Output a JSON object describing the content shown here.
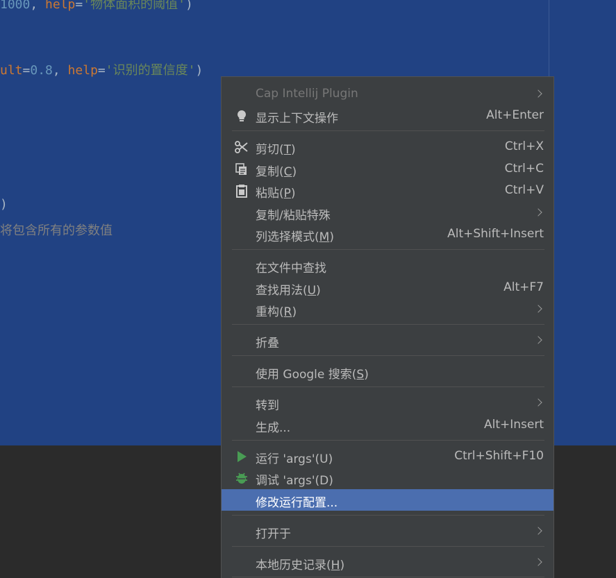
{
  "editor": {
    "line1": {
      "num": "1000",
      "sep": ", ",
      "kw": "help",
      "eq": "=",
      "str": "'物体面积的阈值'",
      "close": ")"
    },
    "line2": {
      "kw_tail": "ult",
      "eq1": "=",
      "num": "0.8",
      "sep": ", ",
      "kw": "help",
      "eq2": "=",
      "str": "'识别的置信度'",
      "close": ")"
    },
    "line3": ")",
    "comment": "将包含所有的参数值"
  },
  "context_menu": {
    "items": [
      {
        "label": "Cap Intellij Plugin",
        "shortcut": "",
        "submenu": true,
        "disabled": true,
        "icon": ""
      },
      {
        "label": "显示上下文操作",
        "shortcut": "Alt+Enter",
        "icon": "lightbulb-icon"
      },
      {
        "label_main": "剪切(",
        "mnemonic": "T",
        "label_end": ")",
        "shortcut": "Ctrl+X",
        "icon": "scissors-icon"
      },
      {
        "label_main": "复制(",
        "mnemonic": "C",
        "label_end": ")",
        "shortcut": "Ctrl+C",
        "icon": "copy-icon"
      },
      {
        "label_main": "粘贴(",
        "mnemonic": "P",
        "label_end": ")",
        "shortcut": "Ctrl+V",
        "icon": "clipboard-icon"
      },
      {
        "label": "复制/粘贴特殊",
        "submenu": true
      },
      {
        "label_main": "列选择模式(",
        "mnemonic": "M",
        "label_end": ")",
        "shortcut": "Alt+Shift+Insert"
      },
      {
        "label": "在文件中查找"
      },
      {
        "label_main": "查找用法(",
        "mnemonic": "U",
        "label_end": ")",
        "shortcut": "Alt+F7"
      },
      {
        "label_main": "重构(",
        "mnemonic": "R",
        "label_end": ")",
        "submenu": true
      },
      {
        "label": "折叠",
        "submenu": true
      },
      {
        "label_main": "使用 Google 搜索(",
        "mnemonic": "S",
        "label_end": ")"
      },
      {
        "label": "转到",
        "submenu": true
      },
      {
        "label": "生成...",
        "shortcut": "Alt+Insert"
      },
      {
        "label": "运行 'args'(U)",
        "shortcut": "Ctrl+Shift+F10",
        "icon": "run-icon"
      },
      {
        "label": "调试 'args'(D)",
        "icon": "debug-bug-icon"
      },
      {
        "label": "修改运行配置...",
        "selected": true
      },
      {
        "label": "打开于",
        "submenu": true
      },
      {
        "label_main": "本地历史记录(",
        "mnemonic": "H",
        "label_end": ")",
        "submenu": true
      }
    ]
  },
  "colors": {
    "editor_bg": "#214283",
    "menu_bg": "#3c3f41",
    "selection": "#4b6eaf",
    "run_green": "#499c54"
  }
}
